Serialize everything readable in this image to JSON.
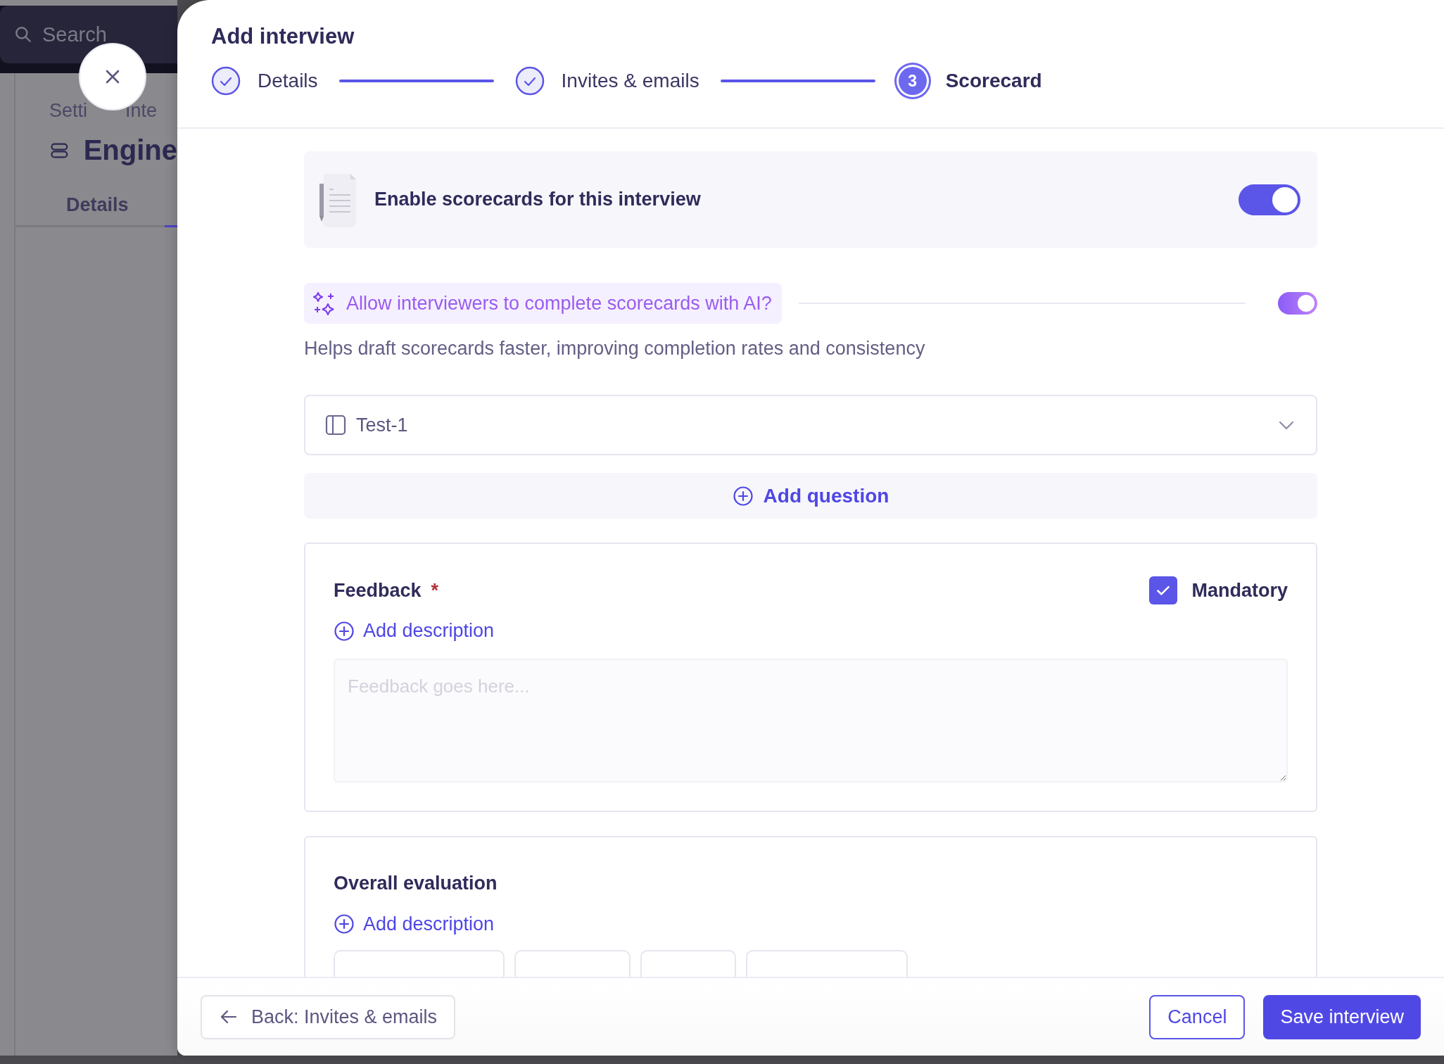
{
  "background": {
    "search": {
      "placeholder": "Search"
    },
    "breadcrumb_start": "Setti",
    "breadcrumb_end": "Inte",
    "title": "Engine",
    "tabs": [
      {
        "label": "Details",
        "selected": false
      }
    ]
  },
  "dialog": {
    "title": "Add interview",
    "steps": [
      {
        "label": "Details",
        "completed": true
      },
      {
        "label": "Invites & emails",
        "completed": true
      },
      {
        "label": "Scorecard",
        "completed": false,
        "number": "3"
      }
    ],
    "enable_card": {
      "label": "Enable scorecards for this interview",
      "on": true
    },
    "ai_option": {
      "label": "Allow interviewers to complete scorecards with AI?",
      "on": true,
      "help": "Helps draft scorecards faster, improving completion rates and consistency"
    },
    "template_select": {
      "value": "Test-1"
    },
    "add_question": "Add question",
    "questions": [
      {
        "kind": "text",
        "title": "Feedback",
        "required_mark": "*",
        "mandatory": {
          "label": "Mandatory",
          "checked": true
        },
        "add_description": "Add description",
        "placeholder": "Feedback goes here..."
      },
      {
        "kind": "choice",
        "title": "Overall evaluation",
        "add_description": "Add description"
      }
    ],
    "footer": {
      "back": "Back: Invites & emails",
      "cancel": "Cancel",
      "save": "Save interview"
    }
  }
}
